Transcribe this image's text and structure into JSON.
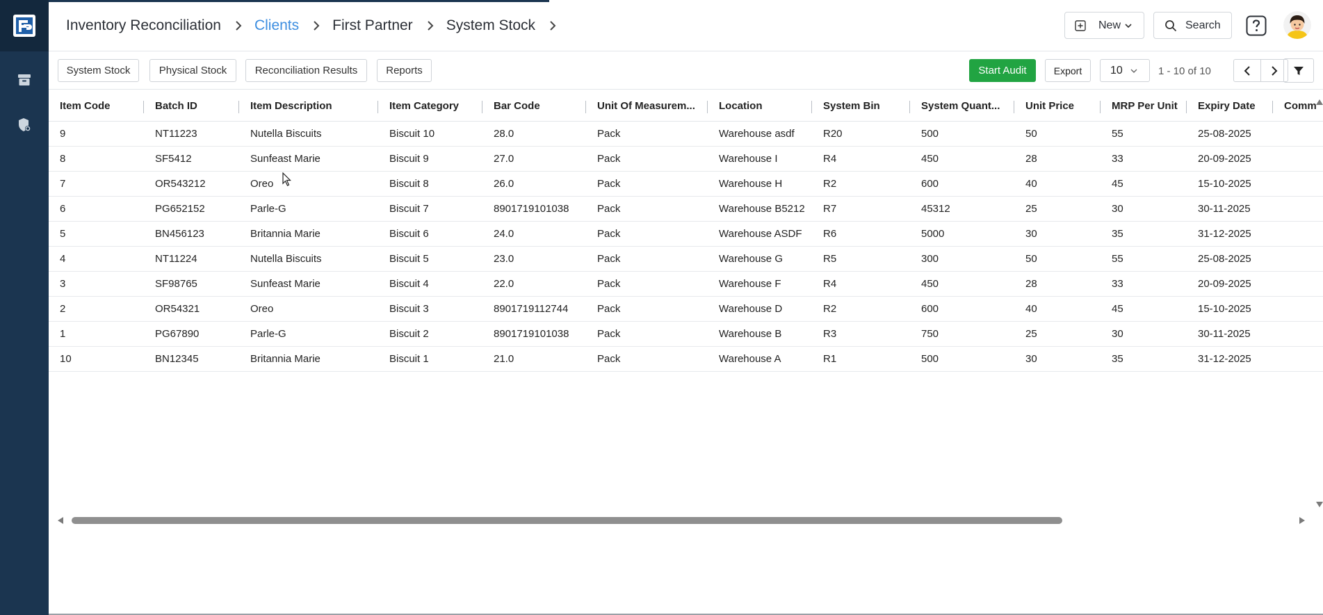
{
  "app": {
    "logo_text": "FP",
    "colors": {
      "rail": "#1b3550",
      "accent": "#3d8ee0",
      "primary_action": "#21a442"
    }
  },
  "rail": {
    "items": [
      {
        "icon": "archive-icon"
      },
      {
        "icon": "shield-settings-icon"
      }
    ]
  },
  "breadcrumb": {
    "items": [
      "Inventory Reconciliation",
      "Clients",
      "First Partner",
      "System Stock"
    ]
  },
  "header": {
    "new_label": "New",
    "search_label": "Search",
    "help_icon": "help-icon",
    "avatar_icon": "avatar"
  },
  "toolbar": {
    "tabs": [
      "System Stock",
      "Physical Stock",
      "Reconciliation Results",
      "Reports"
    ],
    "start_audit_label": "Start Audit",
    "export_label": "Export",
    "page_size": "10",
    "range_text": "1 - 10 of 10"
  },
  "table": {
    "columns": [
      "Item Code",
      "Batch ID",
      "Item Description",
      "Item Category",
      "Bar Code",
      "Unit Of Measurem...",
      "Location",
      "System Bin",
      "System Quant...",
      "Unit Price",
      "MRP Per Unit",
      "Expiry Date",
      "Comm"
    ],
    "rows": [
      [
        "9",
        "NT11223",
        "Nutella Biscuits",
        "Biscuit 10",
        "28.0",
        "Pack",
        "Warehouse asdf",
        "R20",
        "500",
        "50",
        "55",
        "25-08-2025",
        ""
      ],
      [
        "8",
        "SF5412",
        "Sunfeast Marie",
        "Biscuit 9",
        "27.0",
        "Pack",
        "Warehouse I",
        "R4",
        "450",
        "28",
        "33",
        "20-09-2025",
        ""
      ],
      [
        "7",
        "OR543212",
        "Oreo",
        "Biscuit 8",
        "26.0",
        "Pack",
        "Warehouse H",
        "R2",
        "600",
        "40",
        "45",
        "15-10-2025",
        ""
      ],
      [
        "6",
        "PG652152",
        "Parle-G",
        "Biscuit 7",
        "8901719101038",
        "Pack",
        "Warehouse B5212",
        "R7",
        "45312",
        "25",
        "30",
        "30-11-2025",
        ""
      ],
      [
        "5",
        "BN456123",
        "Britannia Marie",
        "Biscuit 6",
        "24.0",
        "Pack",
        "Warehouse ASDF",
        "R6",
        "5000",
        "30",
        "35",
        "31-12-2025",
        ""
      ],
      [
        "4",
        "NT11224",
        "Nutella Biscuits",
        "Biscuit 5",
        "23.0",
        "Pack",
        "Warehouse G",
        "R5",
        "300",
        "50",
        "55",
        "25-08-2025",
        ""
      ],
      [
        "3",
        "SF98765",
        "Sunfeast Marie",
        "Biscuit 4",
        "22.0",
        "Pack",
        "Warehouse F",
        "R4",
        "450",
        "28",
        "33",
        "20-09-2025",
        ""
      ],
      [
        "2",
        "OR54321",
        "Oreo",
        "Biscuit 3",
        "8901719112744",
        "Pack",
        "Warehouse D",
        "R2",
        "600",
        "40",
        "45",
        "15-10-2025",
        ""
      ],
      [
        "1",
        "PG67890",
        "Parle-G",
        "Biscuit 2",
        "8901719101038",
        "Pack",
        "Warehouse B",
        "R3",
        "750",
        "25",
        "30",
        "30-11-2025",
        ""
      ],
      [
        "10",
        "BN12345",
        "Britannia Marie",
        "Biscuit 1",
        "21.0",
        "Pack",
        "Warehouse A",
        "R1",
        "500",
        "30",
        "35",
        "31-12-2025",
        ""
      ]
    ]
  }
}
